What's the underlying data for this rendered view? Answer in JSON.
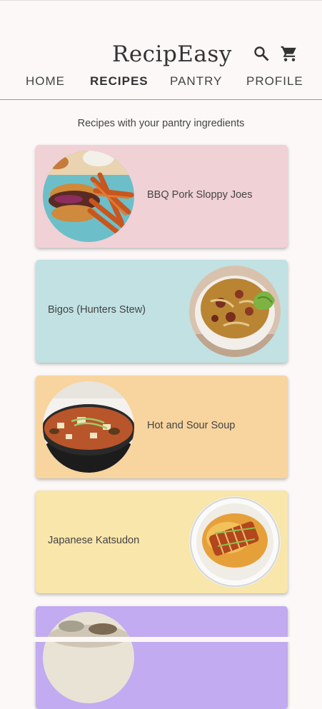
{
  "app": {
    "title": "RecipEasy"
  },
  "header": {
    "search_icon": "search-icon",
    "cart_icon": "cart-icon"
  },
  "nav": {
    "tabs": [
      {
        "label": "HOME",
        "active": false
      },
      {
        "label": "RECIPES",
        "active": true
      },
      {
        "label": "PANTRY",
        "active": false
      },
      {
        "label": "PROFILE",
        "active": false
      }
    ]
  },
  "main": {
    "subtitle": "Recipes with your pantry ingredients",
    "recipes": [
      {
        "title": "BBQ Pork Sloppy Joes",
        "color": "#f0d1d6",
        "image_side": "left"
      },
      {
        "title": "Bigos (Hunters Stew)",
        "color": "#c1e1e3",
        "image_side": "right"
      },
      {
        "title": "Hot and Sour Soup",
        "color": "#f8d49e",
        "image_side": "left"
      },
      {
        "title": "Japanese Katsudon",
        "color": "#f8e6aa",
        "image_side": "right"
      },
      {
        "title": "",
        "color": "#c2abf0",
        "image_side": "left"
      }
    ]
  },
  "colors": {
    "background": "#fcf8f7",
    "text": "#444444",
    "divider": "#9a9a9a"
  }
}
